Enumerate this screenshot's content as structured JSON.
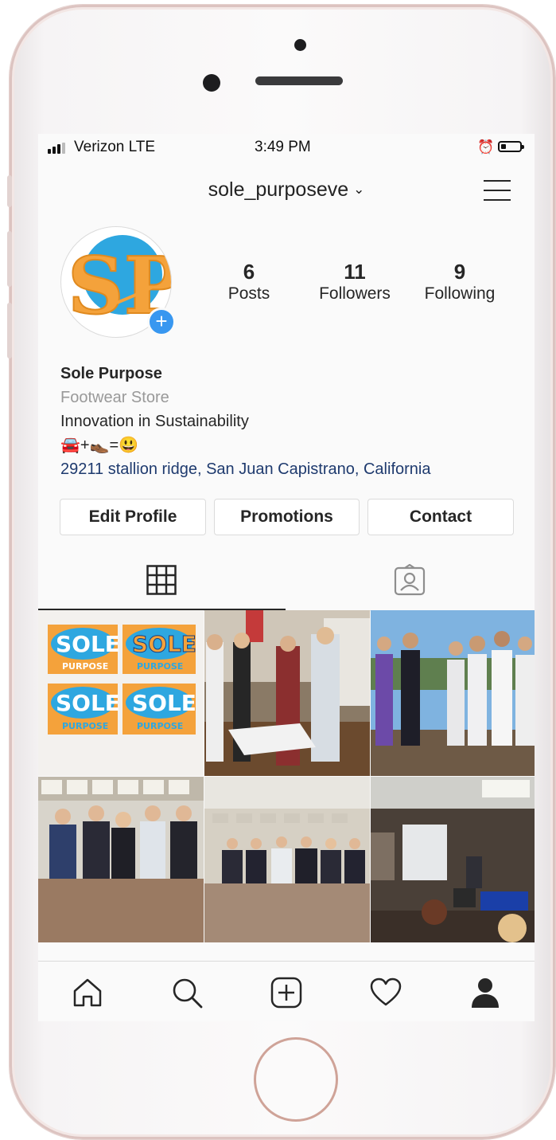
{
  "status_bar": {
    "carrier": "Verizon LTE",
    "time": "3:49 PM"
  },
  "header": {
    "username": "sole_purposeve",
    "chevron": "⌄"
  },
  "profile": {
    "avatar_text": "SP",
    "stats": [
      {
        "value": "6",
        "label": "Posts"
      },
      {
        "value": "11",
        "label": "Followers"
      },
      {
        "value": "9",
        "label": "Following"
      }
    ],
    "name": "Sole Purpose",
    "category": "Footwear Store",
    "tagline": "Innovation in Sustainability",
    "emoji_line": "🚘+👞=😃",
    "address": "29211 stallion ridge, San Juan Capistrano, California"
  },
  "actions": {
    "edit_profile": "Edit Profile",
    "promotions": "Promotions",
    "contact": "Contact"
  },
  "tabs": [
    "grid-icon",
    "tagged-icon"
  ],
  "posts": {
    "logo_word": "SOLE",
    "logo_sub": "PURPOSE",
    "items": [
      "post-logo-collage",
      "post-group-classroom",
      "post-group-outdoors",
      "post-group-conference-room",
      "post-group-table",
      "post-computer-lab"
    ]
  },
  "bottom_nav": [
    "home-icon",
    "search-icon",
    "add-post-icon",
    "heart-icon",
    "profile-icon"
  ],
  "colors": {
    "accent_blue": "#3897f0",
    "address_blue": "#1e3a6e",
    "logo_orange": "#f4a23b",
    "logo_sky": "#2ea7e0"
  }
}
